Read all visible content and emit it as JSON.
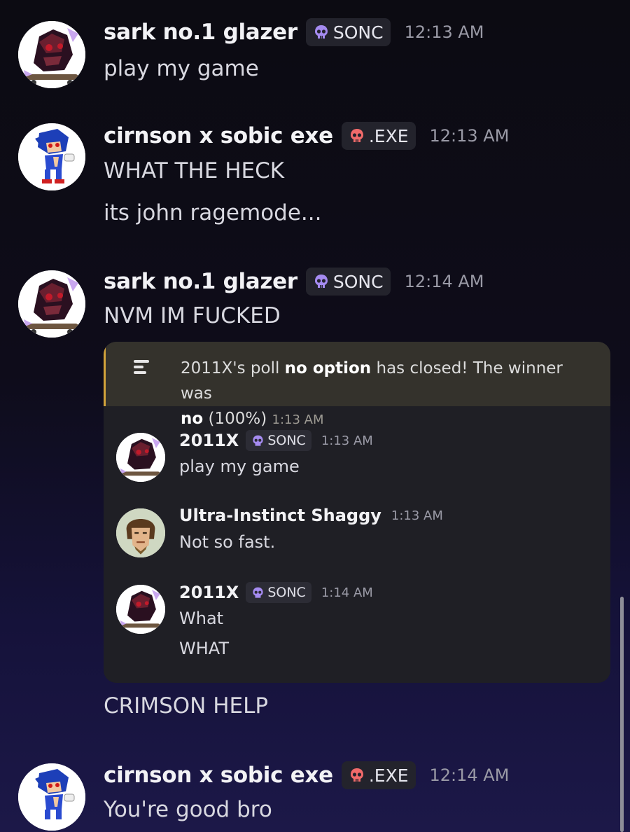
{
  "messages": [
    {
      "username": "sark no.1 glazer",
      "tag": "SONC",
      "tag_icon": "purple-skull-icon",
      "time": "12:13 AM",
      "lines": [
        "play my game"
      ]
    },
    {
      "username": "cirnson x sobic exe",
      "tag": ".EXE",
      "tag_icon": "red-skull-icon",
      "time": "12:13 AM",
      "lines": [
        "WHAT THE HECK",
        "its john ragemode..."
      ]
    },
    {
      "username": "sark no.1 glazer",
      "tag": "SONC",
      "tag_icon": "purple-skull-icon",
      "time": "12:14 AM",
      "lines": [
        "NVM IM FUCKED",
        "CRIMSON HELP"
      ]
    },
    {
      "username": "cirnson x sobic exe",
      "tag": ".EXE",
      "tag_icon": "red-skull-icon",
      "time": "12:14 AM",
      "lines": [
        "You're good bro"
      ]
    }
  ],
  "quote": {
    "poll": {
      "icon": "poll-icon",
      "part1": "2011X's poll ",
      "poll_name": "no option",
      "part2": " has closed! The winner was",
      "winner": "no",
      "percent": " (100%) ",
      "time": "1:13 AM"
    },
    "messages": [
      {
        "username": "2011X",
        "tag": "SONC",
        "time": "1:13 AM",
        "lines": [
          "play my game"
        ]
      },
      {
        "username": "Ultra-Instinct Shaggy",
        "tag": "",
        "time": "1:13 AM",
        "lines": [
          "Not so fast."
        ]
      },
      {
        "username": "2011X",
        "tag": "SONC",
        "time": "1:14 AM",
        "lines": [
          "What",
          "WHAT"
        ]
      }
    ]
  },
  "colors": {
    "sonc_tag_icon": "#a58bf0",
    "exe_tag_icon": "#f06a6a",
    "poll_accent": "#d2a33a"
  }
}
